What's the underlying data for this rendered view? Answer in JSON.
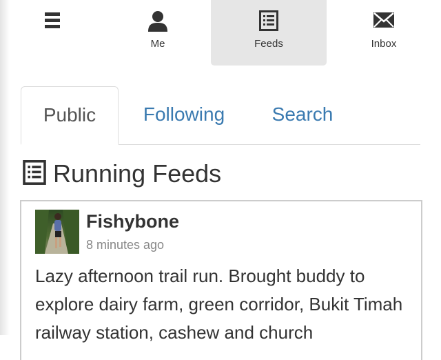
{
  "nav": {
    "items": [
      {
        "key": "menu",
        "label": "",
        "icon": "hamburger-menu-icon"
      },
      {
        "key": "me",
        "label": "Me",
        "icon": "user-icon"
      },
      {
        "key": "feeds",
        "label": "Feeds",
        "icon": "feed-list-icon",
        "active": true
      },
      {
        "key": "inbox",
        "label": "Inbox",
        "icon": "envelope-icon"
      }
    ]
  },
  "tabs": [
    {
      "label": "Public",
      "active": true
    },
    {
      "label": "Following",
      "active": false
    },
    {
      "label": "Search",
      "active": false
    }
  ],
  "section": {
    "title": "Running Feeds",
    "icon": "feed-list-icon"
  },
  "feed": {
    "items": [
      {
        "author": "Fishybone",
        "time": "8 minutes ago",
        "text": "Lazy afternoon trail run. Brought buddy to explore dairy farm, green corridor, Bukit Timah railway station, cashew and church"
      }
    ]
  },
  "colors": {
    "link": "#3a7ab0",
    "text": "#333333",
    "muted": "#888888",
    "active_nav_bg": "#e6e6e6",
    "border": "#dddddd"
  }
}
